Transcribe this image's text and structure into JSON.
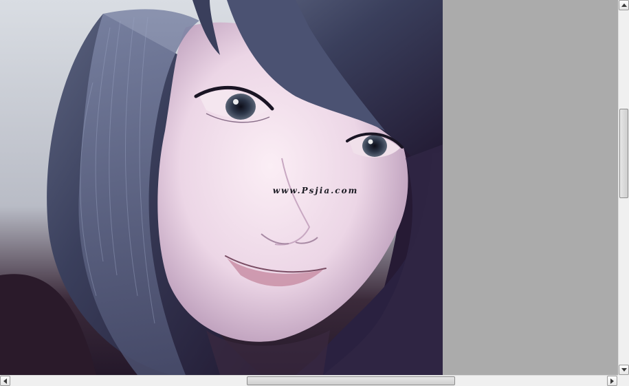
{
  "artwork": {
    "description_icon": "portrait-illustration",
    "watermark": "www.Psjia.com"
  },
  "scrollbars": {
    "vertical": {
      "up_icon": "arrow-up-icon",
      "down_icon": "arrow-down-icon"
    },
    "horizontal": {
      "left_icon": "arrow-left-icon",
      "right_icon": "arrow-right-icon"
    }
  },
  "colors": {
    "workspace": "#ababab",
    "scrollbar_track": "#f0f0f0",
    "scrollbar_thumb": "#d8d8d8"
  }
}
